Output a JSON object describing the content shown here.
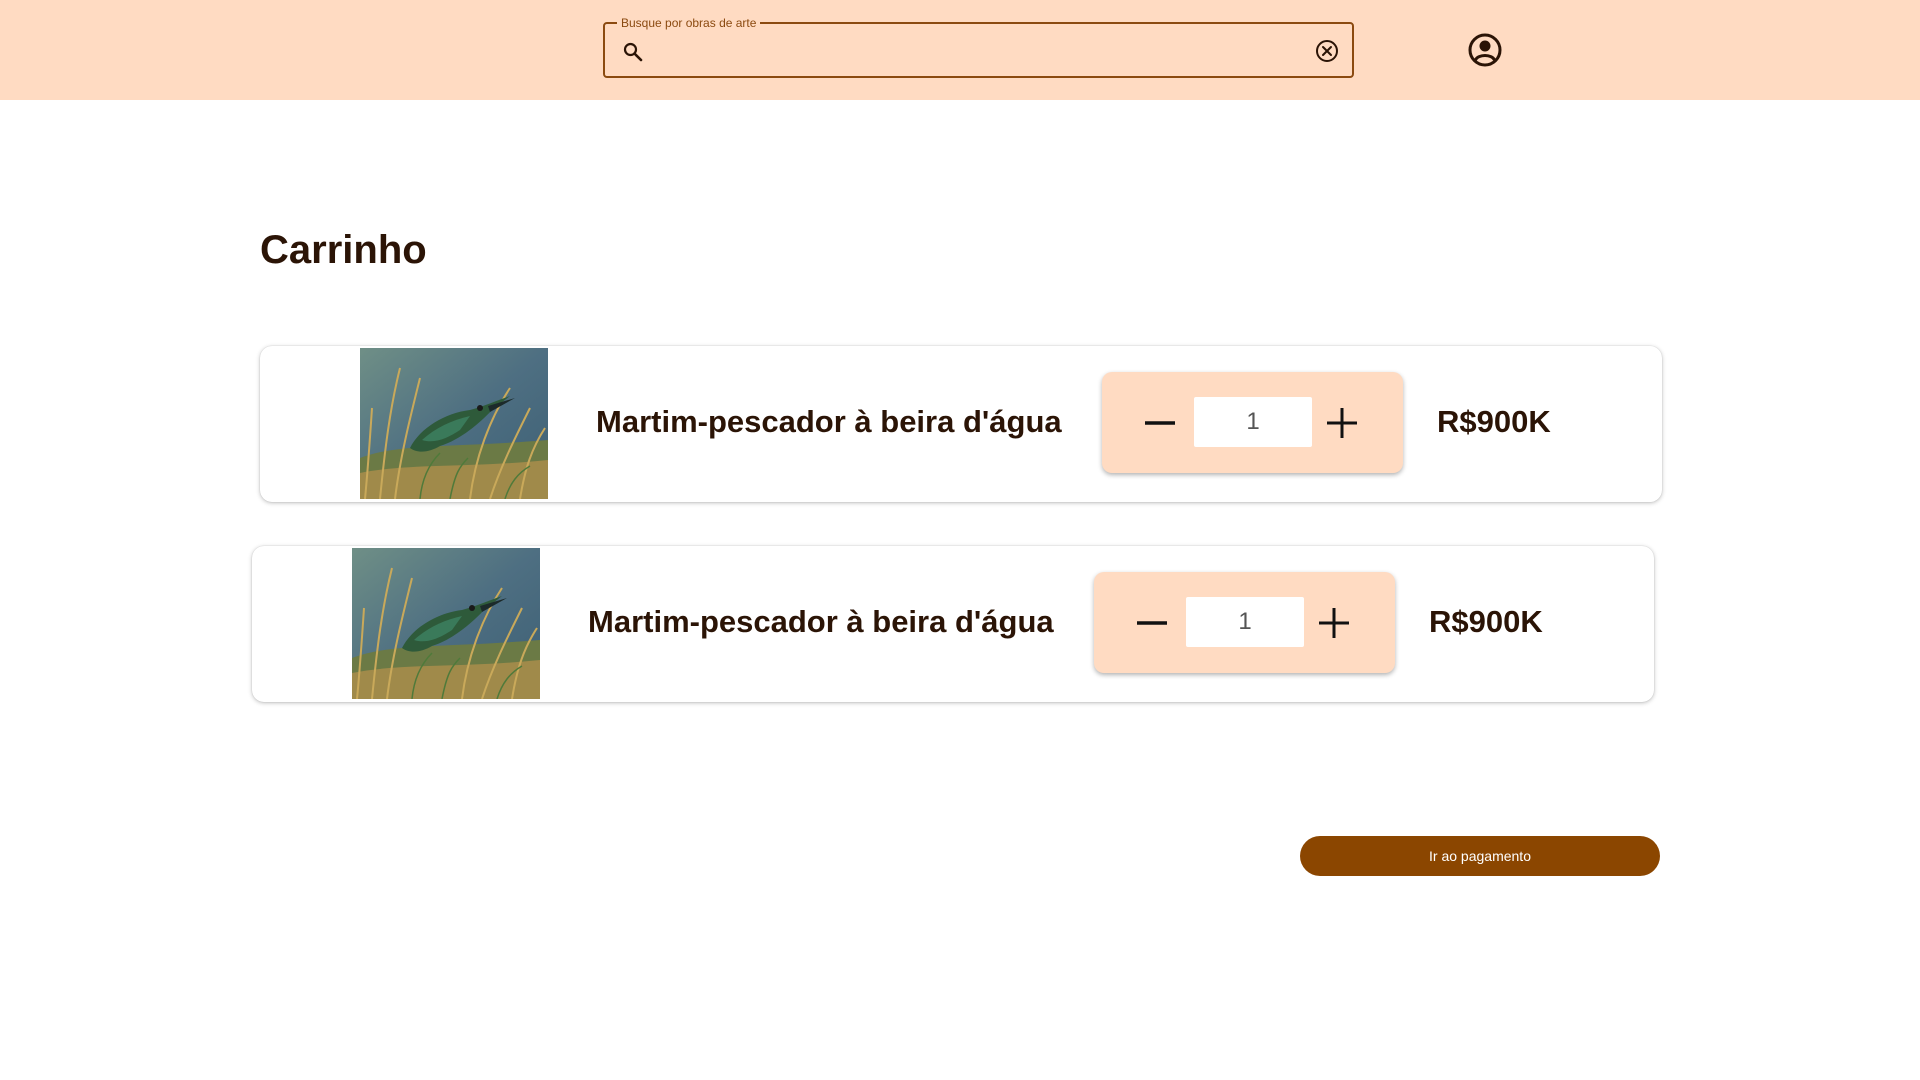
{
  "search": {
    "label": "Busque por obras de arte",
    "value": "",
    "placeholder": ""
  },
  "page": {
    "title": "Carrinho"
  },
  "cart": {
    "items": [
      {
        "title": "Martim-pescador à beira d'água",
        "quantity": "1",
        "price": "R$900K"
      },
      {
        "title": "Martim-pescador à beira d'água",
        "quantity": "1",
        "price": "R$900K"
      }
    ]
  },
  "actions": {
    "pay_label": "Ir ao pagamento"
  },
  "icons": {
    "search": "search-icon",
    "clear": "close-circle-icon",
    "account": "account-circle-icon",
    "minus": "minus-icon",
    "plus": "plus-icon"
  },
  "colors": {
    "header_bg": "#ffdbc2",
    "accent": "#8b4600",
    "text": "#2b1406"
  }
}
